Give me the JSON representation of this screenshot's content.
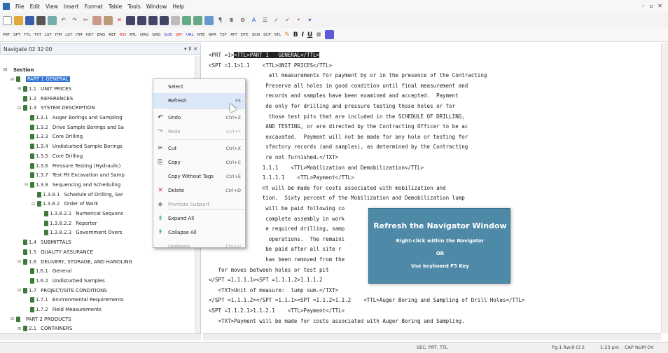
{
  "menubar": {
    "items": [
      "File",
      "Edit",
      "View",
      "Insert",
      "Format",
      "Table",
      "Tools",
      "Window",
      "Help"
    ],
    "window_controls": "– ▫ ✕"
  },
  "toolbar2": {
    "tags": [
      "PRT",
      "SPT",
      "TTL",
      "TXT",
      "LST",
      "ITM",
      "LST",
      "ITM",
      "HET",
      "ENG",
      "REF",
      "RID",
      "RTL",
      "ORG",
      "GAD",
      "SUB",
      "SRF",
      "URL",
      "NTE",
      "NPR",
      "TST",
      "ATT",
      "DTE",
      "SCN",
      "SCP",
      "STL"
    ],
    "bold": "B",
    "italic": "I",
    "underline": "U"
  },
  "navigator": {
    "title": "Navigate 02 32 00",
    "controls": "▾ ⊼ ✕",
    "nodes": [
      {
        "indent": 0,
        "toggle": "⊟",
        "num": "",
        "label": "Section",
        "bold": true,
        "doc": false
      },
      {
        "indent": 1,
        "toggle": "⊟",
        "num": "",
        "label": "PART 1  GENERAL",
        "sel": true,
        "doc": true
      },
      {
        "indent": 2,
        "toggle": "⊞",
        "num": "1.1",
        "label": "UNIT PRICES",
        "doc": true
      },
      {
        "indent": 2,
        "toggle": "",
        "num": "1.2",
        "label": "REFERENCES",
        "doc": true
      },
      {
        "indent": 2,
        "toggle": "⊟",
        "num": "1.3",
        "label": "SYSTEM DESCRIPTION",
        "doc": true
      },
      {
        "indent": 3,
        "toggle": "",
        "num": "1.3.1",
        "label": "Auger Borings and Sampling",
        "doc": true
      },
      {
        "indent": 3,
        "toggle": "",
        "num": "1.3.2",
        "label": "Drive Sample Borings and Sa",
        "doc": true
      },
      {
        "indent": 3,
        "toggle": "",
        "num": "1.3.3",
        "label": "Core Drilling",
        "doc": true
      },
      {
        "indent": 3,
        "toggle": "",
        "num": "1.3.4",
        "label": "Undisturbed Sample Borings",
        "doc": true
      },
      {
        "indent": 3,
        "toggle": "",
        "num": "1.3.5",
        "label": "Core Drilling",
        "doc": true
      },
      {
        "indent": 3,
        "toggle": "",
        "num": "1.3.6",
        "label": "Pressure Testing (Hydraulic)",
        "doc": true
      },
      {
        "indent": 3,
        "toggle": "",
        "num": "1.3.7",
        "label": "Test Pit Excavation and Samp",
        "doc": true
      },
      {
        "indent": 3,
        "toggle": "⊟",
        "num": "1.3.8",
        "label": "Sequencing and Scheduling",
        "doc": true
      },
      {
        "indent": 4,
        "toggle": "",
        "num": "1.3.8.1",
        "label": "Schedule of Drilling, Sar",
        "doc": true
      },
      {
        "indent": 4,
        "toggle": "⊟",
        "num": "1.3.8.2",
        "label": "Order of Work",
        "doc": true
      },
      {
        "indent": 5,
        "toggle": "",
        "num": "1.3.8.2.1",
        "label": "Numerical Sequenc",
        "doc": true
      },
      {
        "indent": 5,
        "toggle": "",
        "num": "1.3.8.2.2",
        "label": "Reporter",
        "doc": true
      },
      {
        "indent": 5,
        "toggle": "",
        "num": "1.3.8.2.3",
        "label": "Government Overs",
        "doc": true
      },
      {
        "indent": 2,
        "toggle": "",
        "num": "1.4",
        "label": "SUBMITTALS",
        "doc": true
      },
      {
        "indent": 2,
        "toggle": "",
        "num": "1.5",
        "label": "QUALITY ASSURANCE",
        "doc": true
      },
      {
        "indent": 2,
        "toggle": "⊟",
        "num": "1.6",
        "label": "DELIVERY, STORAGE, AND HANDLING",
        "doc": true
      },
      {
        "indent": 3,
        "toggle": "",
        "num": "1.6.1",
        "label": "General",
        "doc": true
      },
      {
        "indent": 3,
        "toggle": "",
        "num": "1.6.2",
        "label": "Undisturbed Samples",
        "doc": true
      },
      {
        "indent": 2,
        "toggle": "⊟",
        "num": "1.7",
        "label": "PROJECT/SITE CONDITIONS",
        "doc": true
      },
      {
        "indent": 3,
        "toggle": "",
        "num": "1.7.1",
        "label": "Environmental Requirements",
        "doc": true
      },
      {
        "indent": 3,
        "toggle": "",
        "num": "1.7.2",
        "label": "Field Measurements",
        "doc": true
      },
      {
        "indent": 1,
        "toggle": "⊞",
        "num": "",
        "label": "PART 2  PRODUCTS",
        "doc": true
      },
      {
        "indent": 2,
        "toggle": "⊞",
        "num": "2.1",
        "label": "CONTAINERS",
        "doc": true
      }
    ]
  },
  "editor": {
    "lines": [
      {
        "pre": "<PRT =1>",
        "hl": "<TTL>PART 1   GENERAL</TTL>",
        "post": ""
      },
      {
        "pre": "<SPT =1.1>1.1    <TTL>UNIT PRICES</TTL>",
        "hl": "",
        "post": ""
      },
      {
        "pre": "                   all measurements for payment by or in the presence of the Contracting",
        "hl": "",
        "post": ""
      },
      {
        "pre": "                  Preserve all holes in good condition until final measurement and",
        "hl": "",
        "post": ""
      },
      {
        "pre": "                  records and samples have been examined and accepted.  Payment",
        "hl": "",
        "post": ""
      },
      {
        "pre": "                  de only for drilling and pressure testing those holes or for",
        "hl": "",
        "post": ""
      },
      {
        "pre": "                   those test pits that are included in the SCHEDULE OF DRILLING,",
        "hl": "",
        "post": ""
      },
      {
        "pre": "                  AND TESTING, or are directed by the Contracting Officer to be ac",
        "hl": "",
        "post": ""
      },
      {
        "pre": "                  excavated.  Payment will not be made for any hole or testing for",
        "hl": "",
        "post": ""
      },
      {
        "pre": "                  sfactory records (and samples), as determined by the Contracting",
        "hl": "",
        "post": ""
      },
      {
        "pre": "                  re not furnished.</TXT>",
        "hl": "",
        "post": ""
      },
      {
        "pre": "                 1.1.1    <TTL>Mobilization and Demobilization</TTL>",
        "hl": "",
        "post": ""
      },
      {
        "pre": "                 1.1.1.1    <TTL>Payment</TTL>",
        "hl": "",
        "post": ""
      },
      {
        "pre": "                 nt will be made for costs associated with mobilization and",
        "hl": "",
        "post": ""
      },
      {
        "pre": "                 tion.  Sixty percent of the Mobilization and Demobilization lump",
        "hl": "",
        "post": ""
      },
      {
        "pre": "                  will be paid following co",
        "hl": "",
        "post": ""
      },
      {
        "pre": "                  complete assembly in work                                     ry to",
        "hl": "",
        "post": ""
      },
      {
        "pre": "                  e required drilling, samp",
        "hl": "",
        "post": ""
      },
      {
        "pre": "                   operations.  The remaini                                     sum",
        "hl": "",
        "post": ""
      },
      {
        "pre": "                  be paid after all site r",
        "hl": "",
        "post": ""
      },
      {
        "pre": "                  has been removed from the                                      made",
        "hl": "",
        "post": ""
      },
      {
        "pre": "   for moves between holes or test pit",
        "hl": "",
        "post": ""
      },
      {
        "pre": "</SPT =1.1.1.1><SPT =1.1.1.2>1.1.1.2",
        "hl": "",
        "post": ""
      },
      {
        "pre": "   <TXT>Unit of measure:  lump sum.</TXT>",
        "hl": "",
        "post": ""
      },
      {
        "pre": "</SPT =1.1.1.2></SPT =1.1.1><SPT =1.1.2>1.1.2    <TTL>Auger Boring and Sampling of Drill Holes</TTL>",
        "hl": "",
        "post": ""
      },
      {
        "pre": "<SPT =1.1.2.1>1.1.2.1    <TTL>Payment</TTL>",
        "hl": "",
        "post": ""
      },
      {
        "pre": "   <TXT>Payment will be made for costs associated with Auger Boring and Sampling.",
        "hl": "",
        "post": ""
      }
    ]
  },
  "context_menu": {
    "items": [
      {
        "label": "Select",
        "shortcut": "",
        "icon": "",
        "enabled": true,
        "icon_name": "none"
      },
      {
        "label": "Refresh",
        "shortcut": "F5",
        "icon": "",
        "enabled": true,
        "hover": true,
        "icon_name": "none"
      },
      {
        "label": "Undo",
        "shortcut": "Ctrl+Z",
        "icon": "↶",
        "enabled": true,
        "icon_name": "undo-icon"
      },
      {
        "label": "Redo",
        "shortcut": "Ctrl+Y",
        "icon": "↷",
        "enabled": false,
        "icon_name": "redo-icon"
      },
      {
        "label": "Cut",
        "shortcut": "Ctrl+X",
        "icon": "✂",
        "enabled": true,
        "icon_name": "scissors-icon"
      },
      {
        "label": "Copy",
        "shortcut": "Ctrl+C",
        "icon": "⎘",
        "enabled": true,
        "icon_name": "copy-icon"
      },
      {
        "label": "Copy Without Tags",
        "shortcut": "Ctrl+E",
        "icon": "",
        "enabled": true,
        "icon_name": "none"
      },
      {
        "label": "Delete",
        "shortcut": "Ctrl+D",
        "icon": "✕",
        "enabled": true,
        "icon_name": "delete-icon"
      },
      {
        "label": "Promote Subpart",
        "shortcut": "",
        "icon": "◆",
        "enabled": false,
        "icon_name": "promote-icon"
      },
      {
        "label": "Expand All",
        "shortcut": "",
        "icon": "⇟",
        "enabled": true,
        "icon_name": "expand-icon"
      },
      {
        "label": "Collapse All",
        "shortcut": "",
        "icon": "⇞",
        "enabled": true,
        "icon_name": "collapse-icon"
      },
      {
        "label": "Undelete",
        "shortcut": "Ctrl+U",
        "icon": "",
        "enabled": false,
        "icon_name": "none"
      }
    ]
  },
  "tooltip": {
    "title": "Refresh the Navigator Window",
    "line1": "Right-click within the Navigator",
    "line2": "OR",
    "line3": "Use keyboard F5 Key"
  },
  "status": {
    "codes": "SEC, PRT, TTL",
    "position": "Pg:1 Rw:8 Cl:2",
    "time": "1:23 pm",
    "keys": "CAP NUM OV"
  },
  "colors": {
    "selection": "#2f74d0",
    "tooltip_bg": "#4f89a8",
    "highlight": "#222222"
  }
}
